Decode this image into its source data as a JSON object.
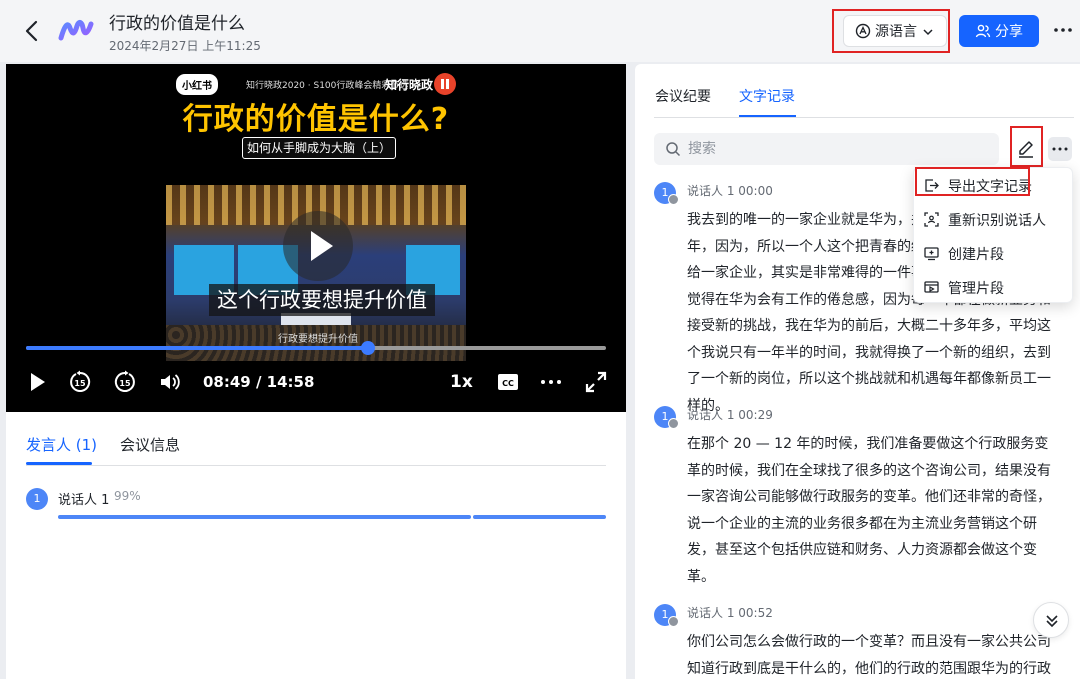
{
  "header": {
    "title": "行政的价值是什么",
    "subtitle": "2024年2月27日 上午11:25",
    "source_lang_label": "源语言",
    "share_label": "分享"
  },
  "video": {
    "platform_logo": "小红书",
    "top_line": "知行晓政2020 · S100行政峰会精彩节选",
    "brand": "知行晓政",
    "title": "行政的价值是什么?",
    "subtitle": "如何从手脚成为大脑（上）",
    "caption": "这个行政要想提升价值",
    "frame_caption": "行政要想提升价值",
    "current_time": "08:49",
    "duration": "14:58",
    "time_display": "08:49 / 14:58",
    "progress": 0.59,
    "speed": "1x",
    "rewind_seconds": "15",
    "forward_seconds": "15"
  },
  "left_tabs": {
    "speakers": "发言人 (1)",
    "meeting_info": "会议信息"
  },
  "speakers": [
    {
      "avatar": "1",
      "name": "说话人 1",
      "percent": "99%",
      "share": 0.99
    }
  ],
  "right_tabs": {
    "summary": "会议纪要",
    "transcript": "文字记录"
  },
  "search": {
    "placeholder": "搜索"
  },
  "menu": {
    "items": [
      {
        "label": "导出文字记录",
        "icon": "export-icon"
      },
      {
        "label": "重新识别说话人",
        "icon": "scan-speaker-icon"
      },
      {
        "label": "创建片段",
        "icon": "create-clip-icon"
      },
      {
        "label": "管理片段",
        "icon": "manage-clip-icon"
      }
    ]
  },
  "transcript": [
    {
      "avatar": "1",
      "speaker": "说话人 1",
      "time": "00:00",
      "meta": "说话人 1  00:00",
      "text": "我去到的唯一的一家企业就是华为，并且在华为待了二十多年，因为，所以一个人这个把青春的绝大多数的时间都奉献给一家企业，其实是非常难得的一件事。但是这个从来不会觉得在华为会有工作的倦怠感，因为每一年都在做新业务和接受新的挑战，我在华为的前后，大概二十多年多，平均这个我说只有一年半的时间，我就得换了一个新的组织，去到了一个新的岗位，所以这个挑战就和机遇每年都像新员工一样的。"
    },
    {
      "avatar": "1",
      "speaker": "说话人 1",
      "time": "00:29",
      "meta": "说话人 1  00:29",
      "text": "在那个 20 — 12 年的时候，我们准备要做这个行政服务变革的时候，我们在全球找了很多的这个咨询公司，结果没有一家咨询公司能够做行政服务的变革。他们还非常的奇怪，说一个企业的主流的业务很多都在为主流业务营销这个研发，甚至这个包括供应链和财务、人力资源都会做这个变革。"
    },
    {
      "avatar": "1",
      "speaker": "说话人 1",
      "time": "00:52",
      "meta": "说话人 1  00:52",
      "text": "你们公司怎么会做行政的一个变革？而且没有一家公共公司知道行政到底是干什么的，他们的行政的范围跟华为的行政"
    }
  ]
}
